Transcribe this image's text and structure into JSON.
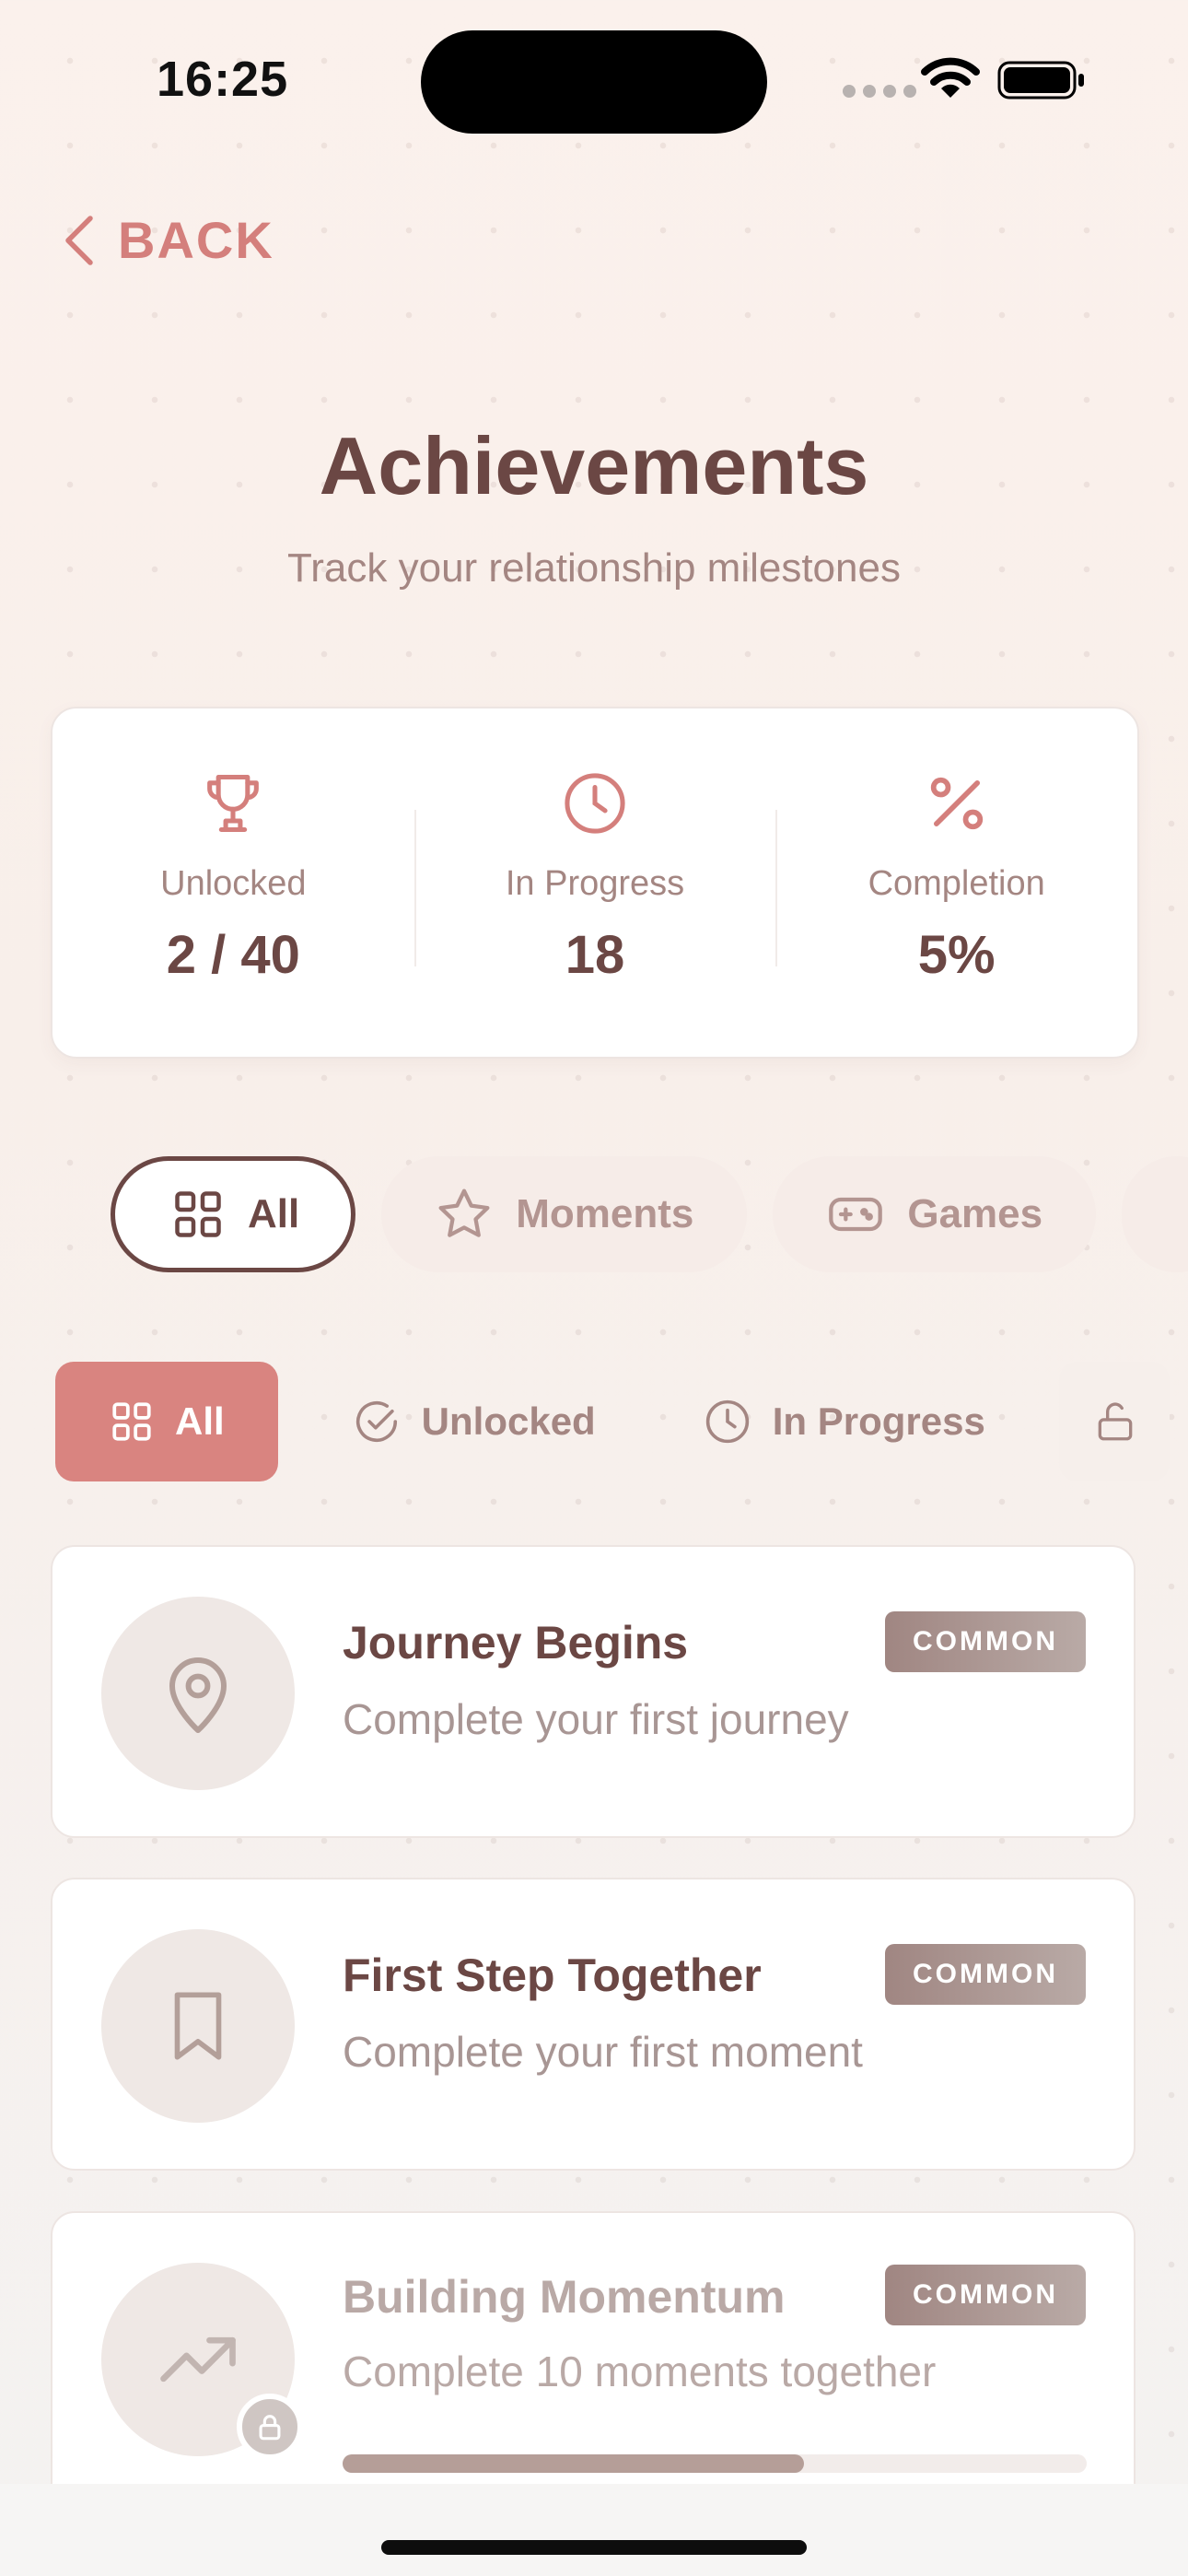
{
  "status_bar": {
    "time": "16:25"
  },
  "nav": {
    "back_label": "BACK"
  },
  "header": {
    "title": "Achievements",
    "subtitle": "Track your relationship milestones"
  },
  "stats": [
    {
      "icon": "trophy-icon",
      "label": "Unlocked",
      "value": "2 / 40"
    },
    {
      "icon": "clock-icon",
      "label": "In Progress",
      "value": "18"
    },
    {
      "icon": "percent-icon",
      "label": "Completion",
      "value": "5%"
    }
  ],
  "categories": [
    {
      "icon": "grid-icon",
      "label": "All",
      "active": true
    },
    {
      "icon": "star-icon",
      "label": "Moments",
      "active": false
    },
    {
      "icon": "gamepad-icon",
      "label": "Games",
      "active": false
    }
  ],
  "filters": [
    {
      "icon": "grid-icon",
      "label": "All",
      "active": true
    },
    {
      "icon": "check-circle-icon",
      "label": "Unlocked",
      "active": false
    },
    {
      "icon": "clock-icon",
      "label": "In Progress",
      "active": false
    }
  ],
  "achievements": [
    {
      "icon": "map-pin-icon",
      "name": "Journey Begins",
      "description": "Complete your first journey",
      "rarity": "COMMON",
      "locked": false
    },
    {
      "icon": "bookmark-icon",
      "name": "First Step Together",
      "description": "Complete your first moment",
      "rarity": "COMMON",
      "locked": false
    },
    {
      "icon": "trending-up-icon",
      "name": "Building Momentum",
      "description": "Complete 10 moments together",
      "rarity": "COMMON",
      "locked": true,
      "progress": 0.62
    }
  ],
  "colors": {
    "accent": "#d47f7c",
    "text_primary": "#6b4744",
    "text_secondary": "#a48682",
    "active_filter_bg": "#d98480"
  }
}
